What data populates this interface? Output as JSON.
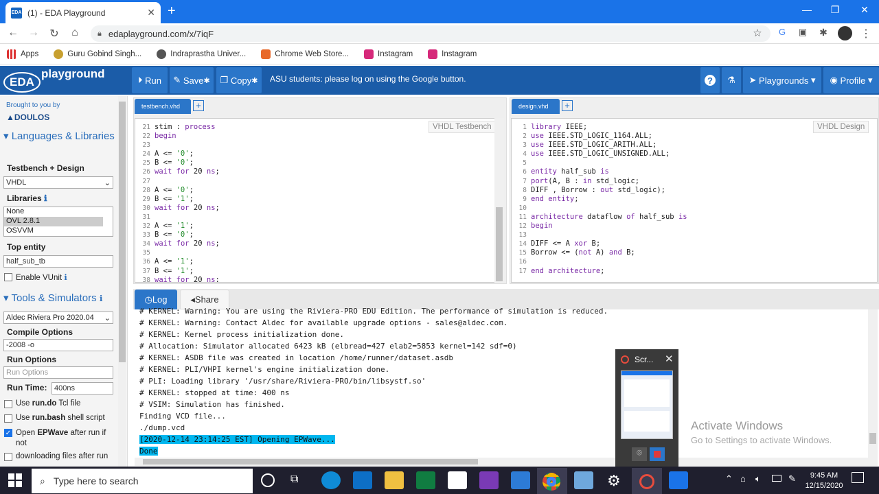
{
  "browser": {
    "tab_title": "(1) - EDA Playground",
    "fav_text": "EDA",
    "url": "edaplayground.com/x/7iqF",
    "bookmarks": [
      "Apps",
      "Guru Gobind Singh...",
      "Indraprastha Univer...",
      "Chrome Web Store...",
      "Instagram",
      "Instagram"
    ]
  },
  "header": {
    "logo_eda": "EDA",
    "logo_playground": "playground",
    "run": "Run",
    "save": "Save",
    "copy": "Copy",
    "notice": "ASU students: please log on using the Google button.",
    "help": "?",
    "playgrounds": "Playgrounds",
    "profile": "Profile"
  },
  "sidebar": {
    "brought": "Brought to you by",
    "doulos": "DOULOS",
    "languages": "Languages & Libraries",
    "tb_design_label": "Testbench + Design",
    "tb_design_value": "VHDL",
    "libraries_label": "Libraries",
    "libraries": [
      "None",
      "OVL 2.8.1",
      "OSVVM"
    ],
    "top_entity_label": "Top entity",
    "top_entity_value": "half_sub_tb",
    "enable_vunit": "Enable VUnit",
    "tools": "Tools & Simulators",
    "simulator": "Aldec Riviera Pro 2020.04",
    "compile_label": "Compile Options",
    "compile_value": "-2008 -o",
    "run_options_label": "Run Options",
    "run_options_placeholder": "Run Options",
    "run_time_label": "Run Time:",
    "run_time_value": "400ns",
    "opt_rundo_a": "Use ",
    "opt_rundo_b": "run.do",
    "opt_rundo_c": " Tcl file",
    "opt_runbash_a": "Use ",
    "opt_runbash_b": "run.bash",
    "opt_runbash_c": " shell script",
    "opt_epwave_a": "Open ",
    "opt_epwave_b": "EPWave",
    "opt_epwave_c": " after run if",
    "opt_epwave_d": "not",
    "opt_download": "downloading files after run"
  },
  "testbench": {
    "tab": "testbench.vhd",
    "label": "VHDL Testbench",
    "lines": [
      {
        "n": "21",
        "code": "stim : process"
      },
      {
        "n": "22",
        "code": "begin"
      },
      {
        "n": "23",
        "code": ""
      },
      {
        "n": "24",
        "code": "A <= '0';"
      },
      {
        "n": "25",
        "code": "B <= '0';"
      },
      {
        "n": "26",
        "code": "wait for 20 ns;"
      },
      {
        "n": "27",
        "code": ""
      },
      {
        "n": "28",
        "code": "A <= '0';"
      },
      {
        "n": "29",
        "code": "B <= '1';"
      },
      {
        "n": "30",
        "code": "wait for 20 ns;"
      },
      {
        "n": "31",
        "code": ""
      },
      {
        "n": "32",
        "code": "A <= '1';"
      },
      {
        "n": "33",
        "code": "B <= '0';"
      },
      {
        "n": "34",
        "code": "wait for 20 ns;"
      },
      {
        "n": "35",
        "code": ""
      },
      {
        "n": "36",
        "code": "A <= '1';"
      },
      {
        "n": "37",
        "code": "B <= '1';"
      },
      {
        "n": "38",
        "code": "wait for 20 ns;"
      }
    ]
  },
  "design": {
    "tab": "design.vhd",
    "label": "VHDL Design",
    "lines": [
      {
        "n": "1",
        "code": "library IEEE;"
      },
      {
        "n": "2",
        "code": "use IEEE.STD_LOGIC_1164.ALL;"
      },
      {
        "n": "3",
        "code": "use IEEE.STD_LOGIC_ARITH.ALL;"
      },
      {
        "n": "4",
        "code": "use IEEE.STD_LOGIC_UNSIGNED.ALL;"
      },
      {
        "n": "5",
        "code": ""
      },
      {
        "n": "6",
        "code": "entity half_sub is"
      },
      {
        "n": "7",
        "code": "port(A, B : in std_logic;"
      },
      {
        "n": "8",
        "code": "DIFF , Borrow : out std_logic);"
      },
      {
        "n": "9",
        "code": "end entity;"
      },
      {
        "n": "10",
        "code": ""
      },
      {
        "n": "11",
        "code": "architecture dataflow of half_sub is"
      },
      {
        "n": "12",
        "code": "begin"
      },
      {
        "n": "13",
        "code": ""
      },
      {
        "n": "14",
        "code": "DIFF <= A xor B;"
      },
      {
        "n": "15",
        "code": "Borrow <= (not A) and B;"
      },
      {
        "n": "16",
        "code": ""
      },
      {
        "n": "17",
        "code": "end architecture;"
      }
    ]
  },
  "log": {
    "tab_log": "Log",
    "tab_share": "Share",
    "lines": [
      "# KERNEL: Warning: You are using the Riviera-PRO EDU Edition. The performance of simulation is reduced.",
      "# KERNEL: Warning: Contact Aldec for available upgrade options - sales@aldec.com.",
      "# KERNEL: Kernel process initialization done.",
      "# Allocation: Simulator allocated 6423 kB (elbread=427 elab2=5853 kernel=142 sdf=0)",
      "# KERNEL: ASDB file was created in location /home/runner/dataset.asdb",
      "# KERNEL: PLI/VHPI kernel's engine initialization done.",
      "# PLI: Loading library '/usr/share/Riviera-PRO/bin/libsystf.so'",
      "# KERNEL: stopped at time: 400 ns",
      "# VSIM: Simulation has finished.",
      "Finding VCD file...",
      "./dump.vcd"
    ],
    "highlight1": "[2020-12-14 23:14:25 EST] Opening EPWave...",
    "highlight2": "Done"
  },
  "popup": {
    "title": "Scr..."
  },
  "watermark": {
    "line1": "Activate Windows",
    "line2": "Go to Settings to activate Windows."
  },
  "taskbar": {
    "search_placeholder": "Type here to search",
    "time": "9:45 AM",
    "date": "12/15/2020"
  }
}
